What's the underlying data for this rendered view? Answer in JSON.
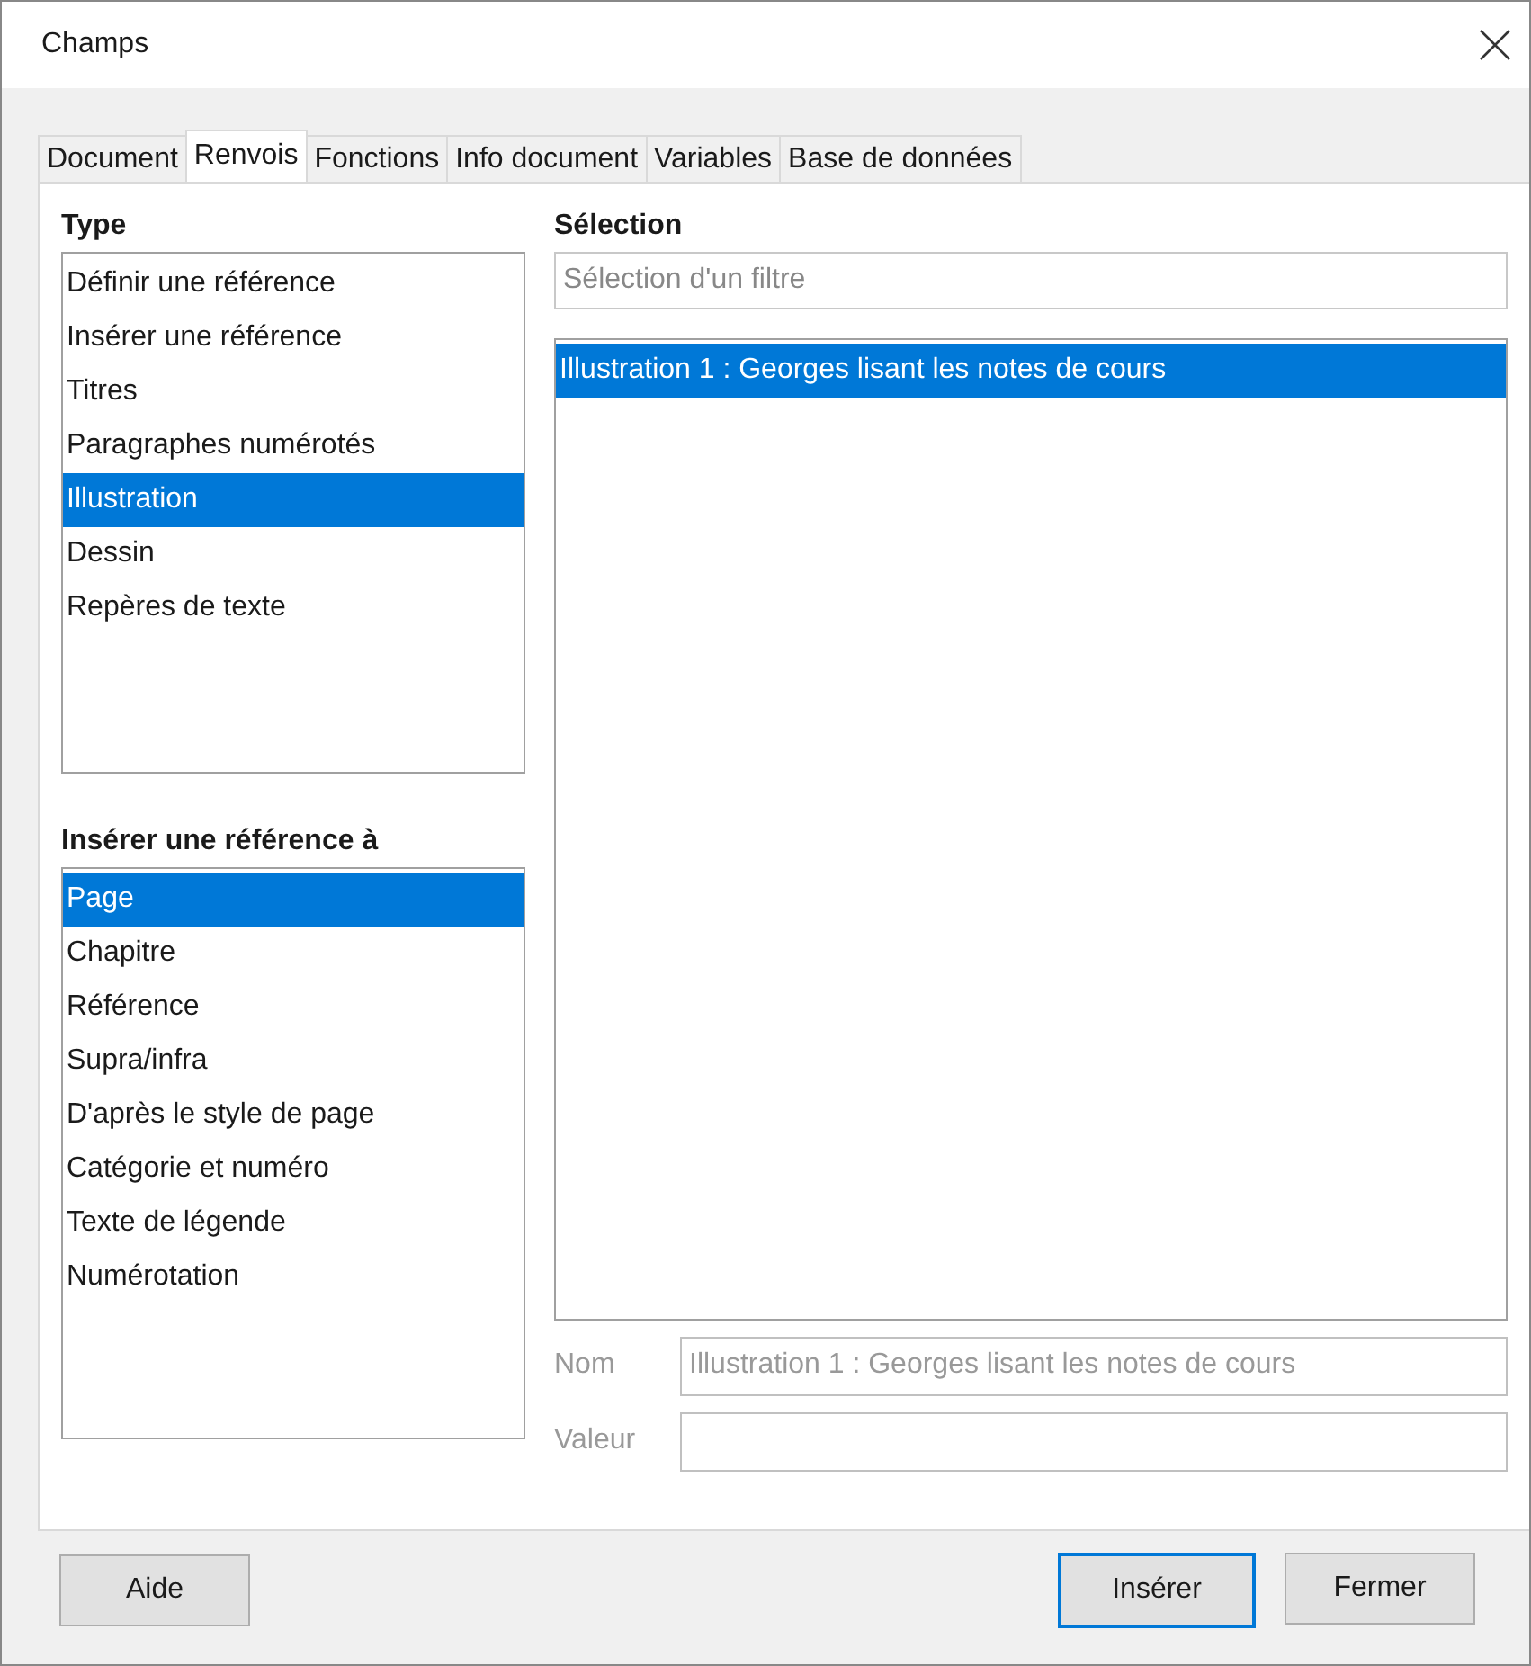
{
  "window": {
    "title": "Champs"
  },
  "tabs": [
    {
      "label": "Document",
      "selected": false
    },
    {
      "label": "Renvois",
      "selected": true
    },
    {
      "label": "Fonctions",
      "selected": false
    },
    {
      "label": "Info document",
      "selected": false
    },
    {
      "label": "Variables",
      "selected": false
    },
    {
      "label": "Base de données",
      "selected": false
    }
  ],
  "type_list": {
    "heading": "Type",
    "items": [
      {
        "label": "Définir une référence",
        "selected": false
      },
      {
        "label": "Insérer une référence",
        "selected": false
      },
      {
        "label": "Titres",
        "selected": false
      },
      {
        "label": "Paragraphes numérotés",
        "selected": false
      },
      {
        "label": "Illustration",
        "selected": true
      },
      {
        "label": "Dessin",
        "selected": false
      },
      {
        "label": "Repères de texte",
        "selected": false
      }
    ]
  },
  "reference_list": {
    "heading": "Insérer une référence à",
    "items": [
      {
        "label": "Page",
        "selected": true
      },
      {
        "label": "Chapitre",
        "selected": false
      },
      {
        "label": "Référence",
        "selected": false
      },
      {
        "label": "Supra/infra",
        "selected": false
      },
      {
        "label": "D'après le style de page",
        "selected": false
      },
      {
        "label": "Catégorie et numéro",
        "selected": false
      },
      {
        "label": "Texte de légende",
        "selected": false
      },
      {
        "label": "Numérotation",
        "selected": false
      }
    ]
  },
  "selection": {
    "heading": "Sélection",
    "filter": {
      "placeholder": "Sélection d'un filtre"
    },
    "items": [
      {
        "label": "Illustration 1 : Georges lisant les notes de cours",
        "selected": true
      }
    ]
  },
  "fields": [
    {
      "label": "Nom",
      "value": "Illustration 1 : Georges lisant les notes de cours",
      "disabled": true
    },
    {
      "label": "Valeur",
      "disabled": true
    }
  ],
  "buttons_left": [
    {
      "label": "Aide",
      "default": false
    }
  ],
  "buttons_right": [
    {
      "label": "Insérer",
      "default": true
    },
    {
      "label": "Fermer",
      "default": false
    }
  ]
}
